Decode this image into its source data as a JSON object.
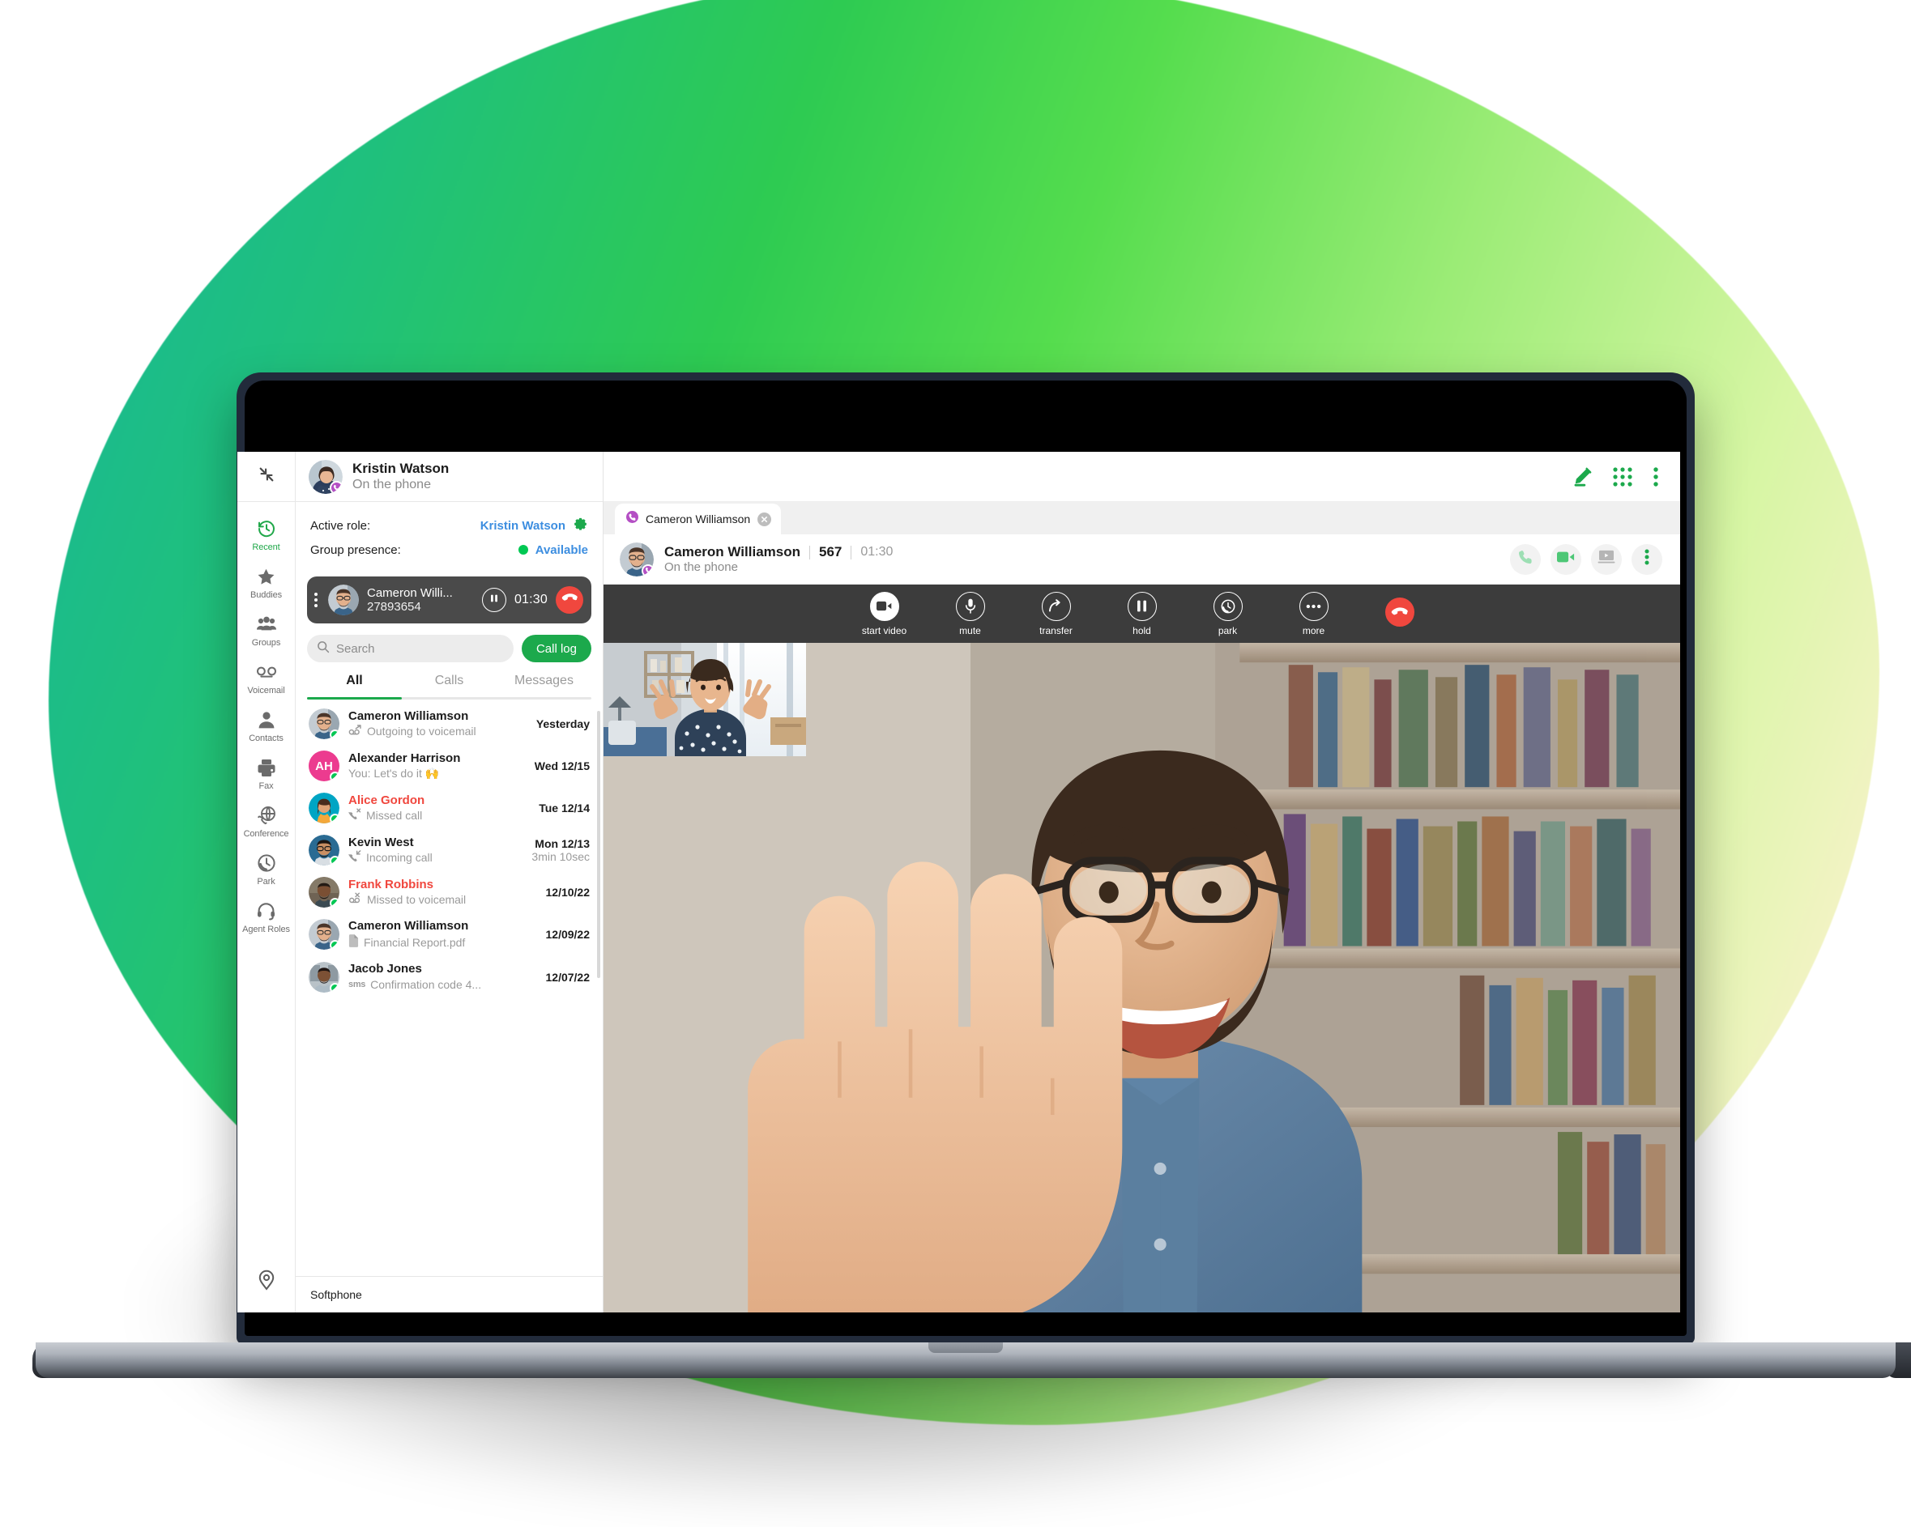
{
  "brand": {
    "green": "#1ca94c",
    "accent_blue": "#3d8ee0",
    "red": "#f0473e",
    "purple": "#b44fc4"
  },
  "rail": {
    "collapse_icon": "collapse-arrows-icon",
    "items": [
      {
        "label": "Recent",
        "icon": "recent-clock-icon",
        "active": true
      },
      {
        "label": "Buddies",
        "icon": "star-icon",
        "active": false
      },
      {
        "label": "Groups",
        "icon": "groups-people-icon",
        "active": false
      },
      {
        "label": "Voicemail",
        "icon": "voicemail-icon",
        "active": false
      },
      {
        "label": "Contacts",
        "icon": "contact-person-icon",
        "active": false
      },
      {
        "label": "Fax",
        "icon": "fax-printer-icon",
        "active": false
      },
      {
        "label": "Conference",
        "icon": "globe-call-icon",
        "active": false
      },
      {
        "label": "Park",
        "icon": "park-clock-call-icon",
        "active": false
      },
      {
        "label": "Agent Roles",
        "icon": "headset-icon",
        "active": false
      }
    ],
    "bottom_icon": "location-pin-icon"
  },
  "me": {
    "name": "Kristin Watson",
    "status": "On the phone",
    "presence_icon": "phone-presence-icon"
  },
  "roles": {
    "active_role_label": "Active role:",
    "active_role_value": "Kristin Watson",
    "settings_icon": "gear-icon",
    "group_presence_label": "Group presence:",
    "group_presence_value": "Available"
  },
  "active_call": {
    "name": "Cameron Willi...",
    "number": "27893654",
    "timer": "01:30",
    "hold_icon": "pause-icon",
    "end_icon": "end-call-icon",
    "grip_icon": "drag-handle-icon"
  },
  "search": {
    "placeholder": "Search",
    "value": "",
    "icon": "search-icon"
  },
  "call_log_button": "Call log",
  "tabs": [
    {
      "label": "All",
      "active": true
    },
    {
      "label": "Calls",
      "active": false
    },
    {
      "label": "Messages",
      "active": false
    }
  ],
  "list": [
    {
      "name": "Cameron Williamson",
      "sub": "Outgoing to voicemail",
      "sub_icon": "outgoing-voicemail-icon",
      "date": "Yesterday",
      "duration": "",
      "missed": false,
      "avatar": "photo-cameron",
      "avatar_color": "#8a9aa8",
      "initials": ""
    },
    {
      "name": "Alexander Harrison",
      "sub": "You: Let's do it 🙌",
      "sub_icon": "",
      "date": "Wed 12/15",
      "duration": "",
      "missed": false,
      "avatar": "initials",
      "avatar_color": "#ec3b8f",
      "initials": "AH"
    },
    {
      "name": "Alice Gordon",
      "sub": "Missed call",
      "sub_icon": "missed-call-icon",
      "date": "Tue 12/14",
      "duration": "",
      "missed": true,
      "avatar": "photo-alice",
      "avatar_color": "#00a5c4",
      "initials": ""
    },
    {
      "name": "Kevin West",
      "sub": "Incoming call",
      "sub_icon": "incoming-call-icon",
      "date": "Mon 12/13",
      "duration": "3min 10sec",
      "missed": false,
      "avatar": "photo-kevin",
      "avatar_color": "#2a6b93",
      "initials": ""
    },
    {
      "name": "Frank Robbins",
      "sub": "Missed to voicemail",
      "sub_icon": "missed-voicemail-icon",
      "date": "12/10/22",
      "duration": "",
      "missed": true,
      "avatar": "photo-frank",
      "avatar_color": "#4a4038",
      "initials": ""
    },
    {
      "name": "Cameron Williamson",
      "sub": "Financial Report.pdf",
      "sub_icon": "file-icon",
      "date": "12/09/22",
      "duration": "",
      "missed": false,
      "avatar": "photo-cameron",
      "avatar_color": "#8a9aa8",
      "initials": ""
    },
    {
      "name": "Jacob Jones",
      "sub": "Confirmation code 4...",
      "sub_icon": "sms-icon",
      "date": "12/07/22",
      "duration": "",
      "missed": false,
      "avatar": "photo-jacob",
      "avatar_color": "#6b7a85",
      "initials": ""
    }
  ],
  "footer": {
    "label": "Softphone"
  },
  "topbar": {
    "compose_icon": "compose-pencil-icon",
    "dialpad_icon": "dialpad-grid-icon",
    "more_icon": "more-vertical-icon"
  },
  "conversation_tab": {
    "label": "Cameron Williamson",
    "icon": "phone-presence-icon",
    "close_icon": "close-icon"
  },
  "call_header": {
    "name": "Cameron Williamson",
    "extension": "567",
    "timer": "01:30",
    "status": "On the phone",
    "actions": [
      {
        "name": "audio-call-icon",
        "icon": "phone-icon"
      },
      {
        "name": "video-call-icon",
        "icon": "video-camera-icon"
      },
      {
        "name": "screen-share-icon",
        "icon": "screen-share-icon"
      },
      {
        "name": "more-options-icon",
        "icon": "more-vertical-icon"
      }
    ]
  },
  "controls": [
    {
      "label": "start video",
      "icon": "video-camera-icon",
      "style": "filled"
    },
    {
      "label": "mute",
      "icon": "microphone-icon",
      "style": "outline"
    },
    {
      "label": "transfer",
      "icon": "transfer-arrow-icon",
      "style": "outline"
    },
    {
      "label": "hold",
      "icon": "pause-icon",
      "style": "outline"
    },
    {
      "label": "park",
      "icon": "park-clock-call-icon",
      "style": "outline"
    },
    {
      "label": "more",
      "icon": "more-horizontal-icon",
      "style": "outline"
    },
    {
      "label": "",
      "icon": "end-call-icon",
      "style": "end"
    }
  ],
  "video": {
    "main_participant": "Cameron Williamson",
    "pip_participant": "Kristin Watson"
  }
}
